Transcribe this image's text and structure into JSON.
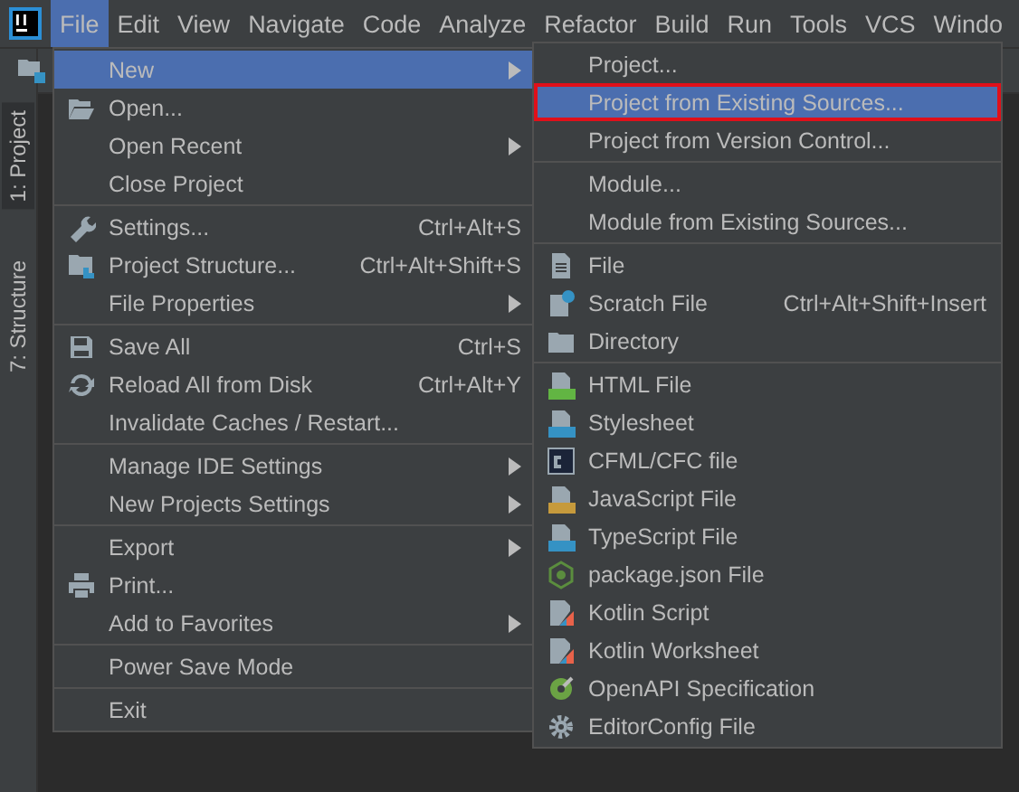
{
  "menubar": [
    {
      "label": "File",
      "selected": true
    },
    {
      "label": "Edit",
      "selected": false
    },
    {
      "label": "View",
      "selected": false
    },
    {
      "label": "Navigate",
      "selected": false
    },
    {
      "label": "Code",
      "selected": false
    },
    {
      "label": "Analyze",
      "selected": false
    },
    {
      "label": "Refactor",
      "selected": false
    },
    {
      "label": "Build",
      "selected": false
    },
    {
      "label": "Run",
      "selected": false
    },
    {
      "label": "Tools",
      "selected": false
    },
    {
      "label": "VCS",
      "selected": false
    },
    {
      "label": "Windo",
      "selected": false
    }
  ],
  "tool_strip": [
    {
      "label": "1: Project"
    },
    {
      "label": "7: Structure"
    }
  ],
  "file_menu": [
    [
      {
        "label": "New",
        "selected": true,
        "submenu": true
      },
      {
        "label": "Open...",
        "selected": false,
        "kind": "folder-open"
      },
      {
        "label": "Open Recent",
        "selected": false,
        "submenu": true
      },
      {
        "label": "Close Project",
        "selected": false
      }
    ],
    [
      {
        "label": "Settings...",
        "selected": false,
        "kind": "wrench",
        "shortcut": "Ctrl+Alt+S"
      },
      {
        "label": "Project Structure...",
        "selected": false,
        "kind": "structure",
        "shortcut": "Ctrl+Alt+Shift+S"
      },
      {
        "label": "File Properties",
        "selected": false,
        "submenu": true
      }
    ],
    [
      {
        "label": "Save All",
        "selected": false,
        "kind": "save",
        "shortcut": "Ctrl+S"
      },
      {
        "label": "Reload All from Disk",
        "selected": false,
        "kind": "reload",
        "shortcut": "Ctrl+Alt+Y"
      },
      {
        "label": "Invalidate Caches / Restart...",
        "selected": false
      }
    ],
    [
      {
        "label": "Manage IDE Settings",
        "selected": false,
        "submenu": true
      },
      {
        "label": "New Projects Settings",
        "selected": false,
        "submenu": true
      }
    ],
    [
      {
        "label": "Export",
        "selected": false,
        "submenu": true
      },
      {
        "label": "Print...",
        "selected": false,
        "kind": "print"
      },
      {
        "label": "Add to Favorites",
        "selected": false,
        "submenu": true
      }
    ],
    [
      {
        "label": "Power Save Mode",
        "selected": false
      }
    ],
    [
      {
        "label": "Exit",
        "selected": false
      }
    ]
  ],
  "new_submenu": [
    [
      {
        "label": "Project...",
        "selected": false
      },
      {
        "label": "Project from Existing Sources...",
        "selected": true
      },
      {
        "label": "Project from Version Control...",
        "selected": false
      }
    ],
    [
      {
        "label": "Module...",
        "selected": false
      },
      {
        "label": "Module from Existing Sources...",
        "selected": false
      }
    ],
    [
      {
        "label": "File",
        "selected": false,
        "kind": "file"
      },
      {
        "label": "Scratch File",
        "selected": false,
        "kind": "scratch",
        "shortcut": "Ctrl+Alt+Shift+Insert"
      },
      {
        "label": "Directory",
        "selected": false,
        "kind": "folder"
      }
    ],
    [
      {
        "label": "HTML File",
        "selected": false,
        "kind": "html"
      },
      {
        "label": "Stylesheet",
        "selected": false,
        "kind": "css"
      },
      {
        "label": "CFML/CFC file",
        "selected": false,
        "kind": "cf"
      },
      {
        "label": "JavaScript File",
        "selected": false,
        "kind": "js"
      },
      {
        "label": "TypeScript File",
        "selected": false,
        "kind": "ts"
      },
      {
        "label": "package.json File",
        "selected": false,
        "kind": "nodejs"
      },
      {
        "label": "Kotlin Script",
        "selected": false,
        "kind": "kotlin"
      },
      {
        "label": "Kotlin Worksheet",
        "selected": false,
        "kind": "kotlin"
      },
      {
        "label": "OpenAPI Specification",
        "selected": false,
        "kind": "openapi"
      },
      {
        "label": "EditorConfig File",
        "selected": false,
        "kind": "gear"
      }
    ]
  ]
}
